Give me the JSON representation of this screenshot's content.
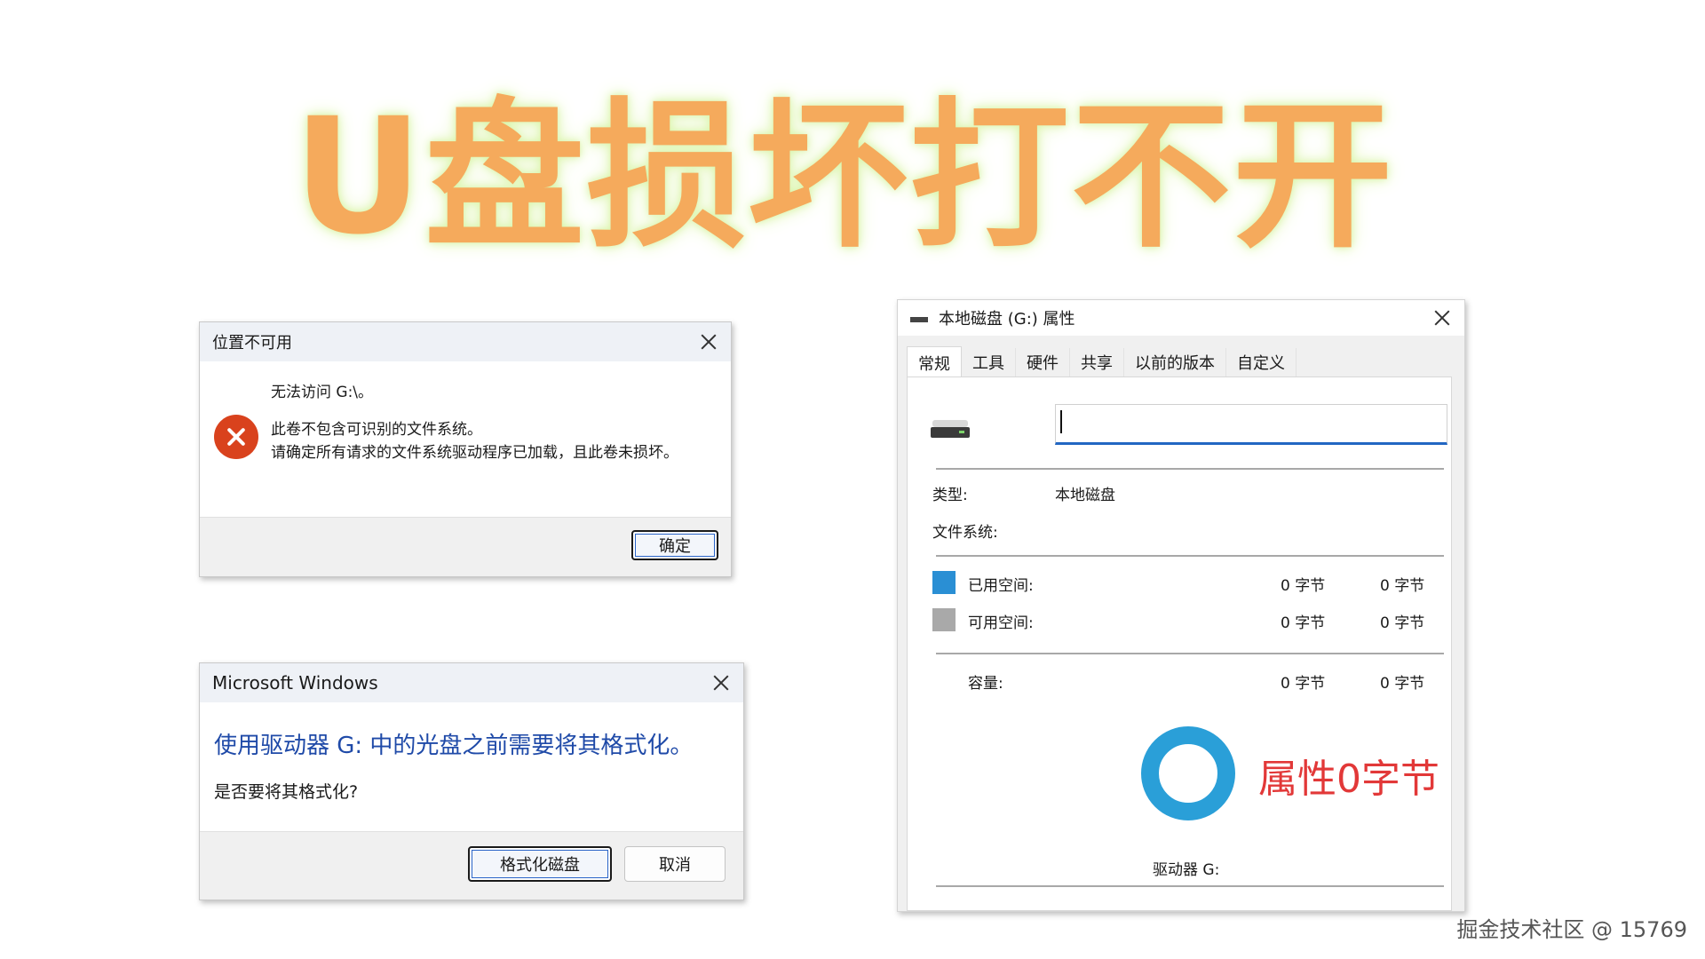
{
  "headline": "U盘损坏打不开",
  "dialog_location": {
    "title": "位置不可用",
    "line1": "无法访问 G:\\。",
    "line2": "此卷不包含可识别的文件系统。",
    "line3": "请确定所有请求的文件系统驱动程序已加载，且此卷未损坏。",
    "ok_label": "确定"
  },
  "dialog_format": {
    "title": "Microsoft Windows",
    "heading": "使用驱动器 G: 中的光盘之前需要将其格式化。",
    "question": "是否要将其格式化?",
    "format_label": "格式化磁盘",
    "cancel_label": "取消"
  },
  "properties": {
    "title": "本地磁盘 (G:) 属性",
    "tabs": [
      "常规",
      "工具",
      "硬件",
      "共享",
      "以前的版本",
      "自定义"
    ],
    "name_value": "",
    "type_label": "类型:",
    "type_value": "本地磁盘",
    "fs_label": "文件系统:",
    "used_label": "已用空间:",
    "used_bytes": "0 字节",
    "used_size": "0 字节",
    "free_label": "可用空间:",
    "free_bytes": "0 字节",
    "free_size": "0 字节",
    "capacity_label": "容量:",
    "capacity_bytes": "0 字节",
    "capacity_size": "0 字节",
    "drive_label": "驱动器 G:",
    "annotation": "属性0字节",
    "used_color": "#2a8fd4",
    "free_color": "#a9a9a9",
    "ring_color": "#2a9fd8"
  },
  "watermark": "掘金技术社区 @ 15769"
}
